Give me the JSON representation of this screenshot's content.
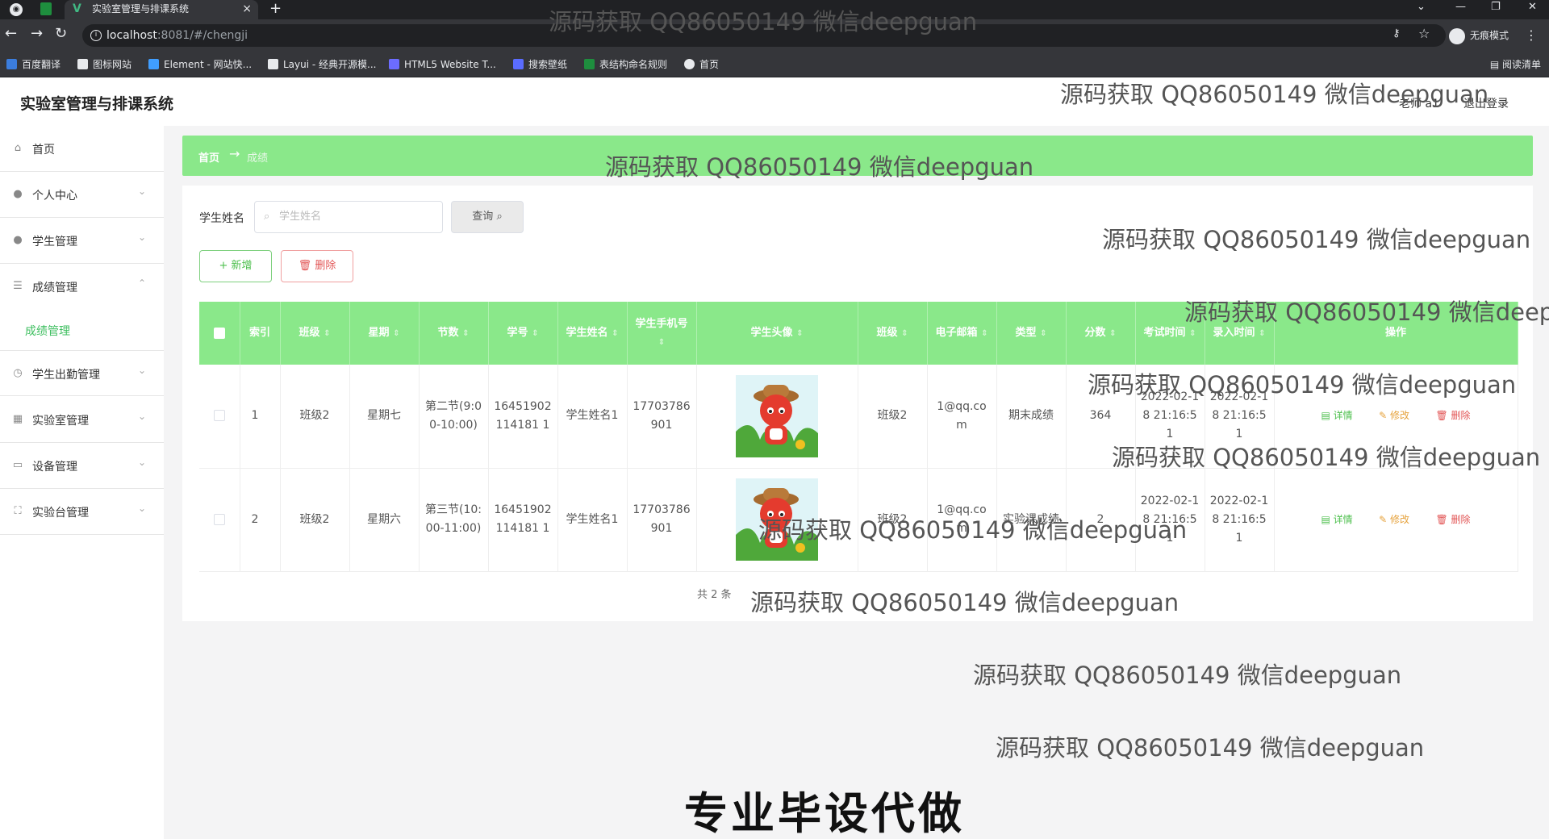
{
  "browser": {
    "tab_title": "实验室管理与排课系统",
    "tab_close": "×",
    "new_tab": "+",
    "url_host": "localhost",
    "url_path": ":8081/#/chengji",
    "incognito_label": "无痕模式",
    "bookmarks": [
      {
        "label": "百度翻译",
        "color": "#3b7ddd"
      },
      {
        "label": "图标网站",
        "color": "#e8eaed"
      },
      {
        "label": "Element - 网站快...",
        "color": "#409eff"
      },
      {
        "label": "Layui - 经典开源模...",
        "color": "#e8eaed"
      },
      {
        "label": "HTML5 Website T...",
        "color": "#6c6cff"
      },
      {
        "label": "搜索壁纸",
        "color": "#5a6cff"
      },
      {
        "label": "表结构命名规则",
        "color": "#1e8e3e"
      },
      {
        "label": "首页",
        "color": "#e8eaed"
      }
    ],
    "reading_list": "阅读清单"
  },
  "app": {
    "title": "实验室管理与排课系统",
    "user": "老师 a1",
    "logout": "退出登录"
  },
  "sidebar": {
    "items": [
      {
        "label": "首页",
        "icon": "home-icon",
        "glyph": "⌂",
        "arrow": ""
      },
      {
        "label": "个人中心",
        "icon": "user-icon",
        "glyph": "●",
        "arrow": "⌄"
      },
      {
        "label": "学生管理",
        "icon": "user-icon",
        "glyph": "●",
        "arrow": "⌄"
      },
      {
        "label": "成绩管理",
        "icon": "sliders-icon",
        "glyph": "☰",
        "arrow": "⌃"
      },
      {
        "label": "学生出勤管理",
        "icon": "clock-icon",
        "glyph": "◷",
        "arrow": "⌄"
      },
      {
        "label": "实验室管理",
        "icon": "grid-icon",
        "glyph": "▦",
        "arrow": "⌄"
      },
      {
        "label": "设备管理",
        "icon": "monitor-icon",
        "glyph": "▭",
        "arrow": "⌄"
      },
      {
        "label": "实验台管理",
        "icon": "frame-icon",
        "glyph": "⛶",
        "arrow": "⌄"
      }
    ],
    "sub_item": "成绩管理"
  },
  "breadcrumb": {
    "home": "首页",
    "arrow": "→",
    "current": "成绩"
  },
  "search": {
    "label": "学生姓名",
    "placeholder": "学生姓名",
    "query_button": "查询",
    "add_button": "+ 新增",
    "delete_button": "删除"
  },
  "table": {
    "headers": [
      "",
      "索引",
      "班级",
      "星期",
      "节数",
      "学号",
      "学生姓名",
      "学生手机号",
      "学生头像",
      "班级",
      "电子邮箱",
      "类型",
      "分数",
      "考试时间",
      "录入时间",
      "操作"
    ],
    "rows": [
      {
        "index": "1",
        "class": "班级2",
        "weekday": "星期七",
        "period": "第二节(9:00-10:00)",
        "student_no": "16451902114181 1",
        "name": "学生姓名1",
        "phone": "17703786901",
        "class2": "班级2",
        "email": "1@qq.com",
        "type": "期末成绩",
        "score": "364",
        "exam_time": "2022-02-18 21:16:51",
        "entry_time": "2022-02-18 21:16:51"
      },
      {
        "index": "2",
        "class": "班级2",
        "weekday": "星期六",
        "period": "第三节(10:00-11:00)",
        "student_no": "16451902114181 1",
        "name": "学生姓名1",
        "phone": "17703786901",
        "class2": "班级2",
        "email": "1@qq.com",
        "type": "实验课成绩",
        "score": "2",
        "exam_time": "2022-02-18 21:16:51",
        "entry_time": "2022-02-18 21:16:51"
      }
    ],
    "actions": {
      "detail": "详情",
      "edit": "修改",
      "delete": "删除"
    }
  },
  "pagination": {
    "total": "共 2 条"
  },
  "overlay": {
    "watermark": "源码获取 QQ86050149 微信deepguan",
    "banner": "专业毕设代做"
  }
}
